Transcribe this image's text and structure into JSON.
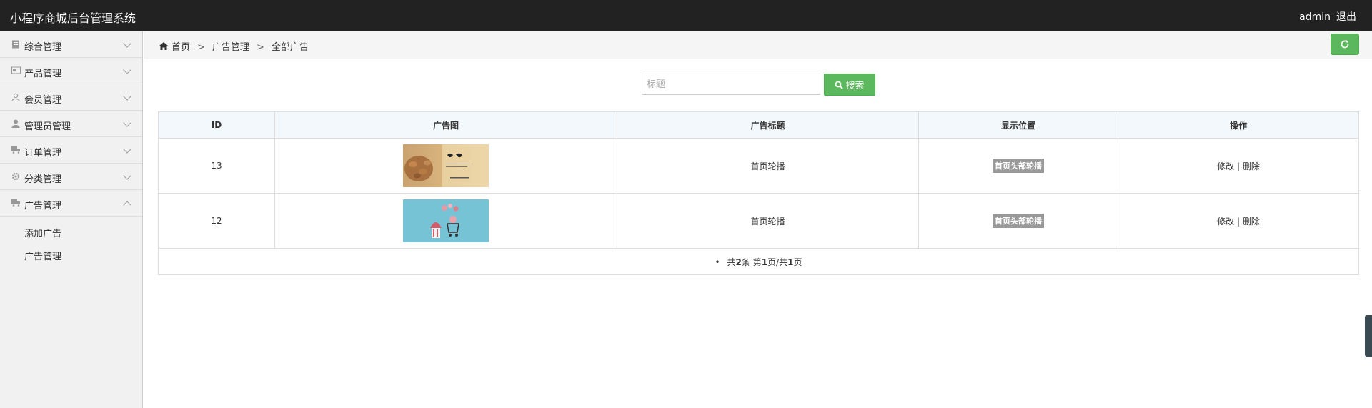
{
  "app": {
    "title": "小程序商城后台管理系统",
    "user": "admin",
    "logout": "退出"
  },
  "sidebar": {
    "items": [
      {
        "label": "综合管理",
        "icon": "document-icon"
      },
      {
        "label": "产品管理",
        "icon": "card-icon"
      },
      {
        "label": "会员管理",
        "icon": "user-outline-icon"
      },
      {
        "label": "管理员管理",
        "icon": "user-icon"
      },
      {
        "label": "订单管理",
        "icon": "truck-icon"
      },
      {
        "label": "分类管理",
        "icon": "gear-icon"
      },
      {
        "label": "广告管理",
        "icon": "truck-icon"
      }
    ],
    "sub_items": [
      "添加广告",
      "广告管理"
    ]
  },
  "breadcrumb": {
    "home": "首页",
    "level1": "广告管理",
    "level2": "全部广告",
    "separator": ">"
  },
  "search": {
    "placeholder": "标题",
    "button_label": "搜索"
  },
  "table": {
    "headers": [
      "ID",
      "广告图",
      "广告标题",
      "显示位置",
      "操作"
    ],
    "rows": [
      {
        "id": "13",
        "title": "首页轮播",
        "position": "首页头部轮播",
        "edit": "修改",
        "delete": "删除"
      },
      {
        "id": "12",
        "title": "首页轮播",
        "position": "首页头部轮播",
        "edit": "修改",
        "delete": "删除"
      }
    ],
    "action_separator": "|",
    "pager": {
      "bullet": "•",
      "total_prefix": "共",
      "total": "2",
      "total_unit": "条",
      "page_prefix": "第",
      "page": "1",
      "page_mid": "页/共",
      "pages": "1",
      "page_suffix": "页"
    }
  },
  "colors": {
    "topbar": "#222222",
    "accent": "#5cb85c",
    "badge": "#999999",
    "header_bg": "#f3f8fc"
  }
}
